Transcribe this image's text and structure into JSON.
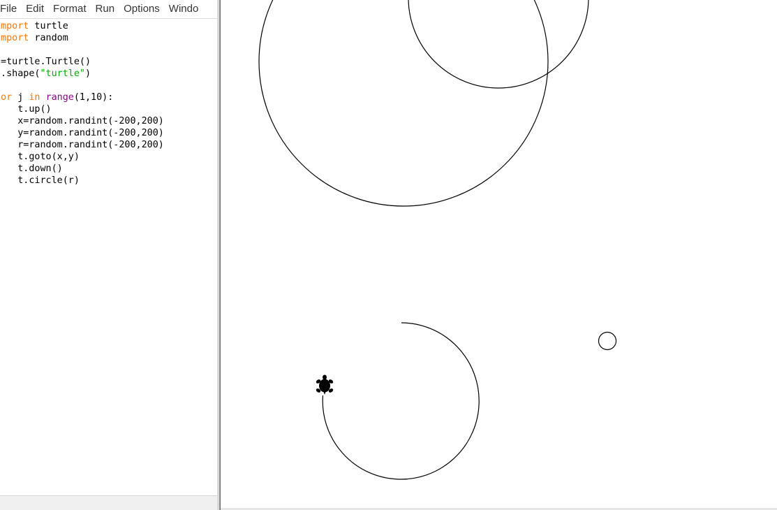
{
  "menubar": {
    "items": [
      {
        "label": "File"
      },
      {
        "label": "Edit"
      },
      {
        "label": "Format"
      },
      {
        "label": "Run"
      },
      {
        "label": "Options"
      },
      {
        "label": "Windo"
      }
    ]
  },
  "editor": {
    "lines": [
      {
        "tokens": [
          {
            "text": "import",
            "cls": "kw"
          },
          {
            "text": " turtle",
            "cls": ""
          }
        ]
      },
      {
        "tokens": [
          {
            "text": "import",
            "cls": "kw"
          },
          {
            "text": " random",
            "cls": ""
          }
        ]
      },
      {
        "tokens": []
      },
      {
        "tokens": [
          {
            "text": "t=turtle.Turtle()",
            "cls": ""
          }
        ]
      },
      {
        "tokens": [
          {
            "text": "t.shape(",
            "cls": ""
          },
          {
            "text": "\"turtle\"",
            "cls": "str"
          },
          {
            "text": ")",
            "cls": ""
          }
        ]
      },
      {
        "tokens": []
      },
      {
        "tokens": [
          {
            "text": "for",
            "cls": "kw"
          },
          {
            "text": " j ",
            "cls": ""
          },
          {
            "text": "in",
            "cls": "kw"
          },
          {
            "text": " ",
            "cls": ""
          },
          {
            "text": "range",
            "cls": "kw-purple"
          },
          {
            "text": "(1,10):",
            "cls": ""
          }
        ]
      },
      {
        "tokens": [
          {
            "text": "    t.up()",
            "cls": ""
          }
        ]
      },
      {
        "tokens": [
          {
            "text": "    x=random.randint(-200,200)",
            "cls": ""
          }
        ]
      },
      {
        "tokens": [
          {
            "text": "    y=random.randint(-200,200)",
            "cls": ""
          }
        ]
      },
      {
        "tokens": [
          {
            "text": "    r=random.randint(-200,200)",
            "cls": ""
          }
        ]
      },
      {
        "tokens": [
          {
            "text": "    t.goto(x,y)",
            "cls": ""
          }
        ]
      },
      {
        "tokens": [
          {
            "text": "    t.down()",
            "cls": ""
          }
        ]
      },
      {
        "tokens": [
          {
            "text": "    t.circle(r)",
            "cls": ""
          }
        ]
      }
    ]
  },
  "canvas": {
    "shapes": [
      {
        "name": "large-circle",
        "type": "circle",
        "x": 0,
        "y": 0,
        "r": 0
      },
      {
        "name": "upper-circle",
        "type": "circle",
        "x": 0,
        "y": 0,
        "r": 0
      },
      {
        "name": "small-circle",
        "type": "circle",
        "x": 0,
        "y": 0,
        "r": 0
      },
      {
        "name": "partial-circle-arc",
        "type": "arc"
      }
    ],
    "turtle": {
      "icon": "turtle-icon",
      "color": "#000000"
    },
    "stroke_color": "#000000"
  },
  "colors": {
    "keyword": "#ff7700",
    "builtin": "#900090",
    "string": "#00aa00"
  }
}
